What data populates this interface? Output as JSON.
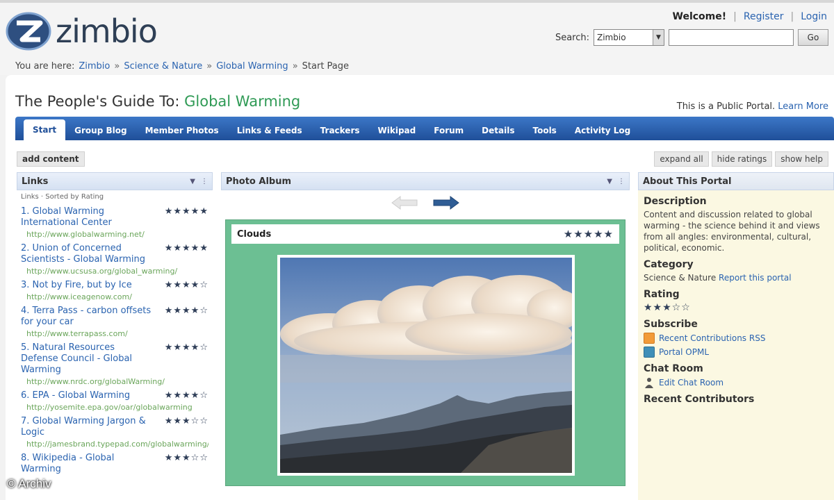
{
  "header": {
    "logo_text": "zimbio",
    "welcome": "Welcome!",
    "register": "Register",
    "login": "Login",
    "search_label": "Search:",
    "search_scope": "Zimbio",
    "go_label": "Go",
    "breadcrumb": {
      "prefix": "You are here:",
      "items": [
        "Zimbio",
        "Science & Nature",
        "Global Warming"
      ],
      "current": "Start Page"
    }
  },
  "portal": {
    "title_prefix": "The People's Guide To:",
    "topic": "Global Warming",
    "public_note": "This is a Public Portal.",
    "learn_more": "Learn More",
    "tabs": [
      "Start",
      "Group Blog",
      "Member Photos",
      "Links & Feeds",
      "Trackers",
      "Wikipad",
      "Forum",
      "Details",
      "Tools",
      "Activity Log"
    ],
    "add_content": "add content",
    "expand_all": "expand all",
    "hide_ratings": "hide ratings",
    "show_help": "show help"
  },
  "links": {
    "title": "Links",
    "subtitle": "Links · Sorted by Rating",
    "items": [
      {
        "title": "1. Global Warming International Center",
        "stars": "★★★★★",
        "url": "http://www.globalwarming.net/"
      },
      {
        "title": "2. Union of Concerned Scientists - Global Warming",
        "stars": "★★★★★",
        "url": "http://www.ucsusa.org/global_warming/"
      },
      {
        "title": "3. Not by Fire, but by Ice",
        "stars": "★★★★☆",
        "url": "http://www.iceagenow.com/"
      },
      {
        "title": "4. Terra Pass - carbon offsets for your car",
        "stars": "★★★★☆",
        "url": "http://www.terrapass.com/"
      },
      {
        "title": "5. Natural Resources Defense Council - Global Warming",
        "stars": "★★★★☆",
        "url": "http://www.nrdc.org/globalWarming/"
      },
      {
        "title": "6. EPA - Global Warming",
        "stars": "★★★★☆",
        "url": "http://yosemite.epa.gov/oar/globalwarming"
      },
      {
        "title": "7. Global Warming Jargon & Logic",
        "stars": "★★★☆☆",
        "url": "http://jamesbrand.typepad.com/globalwarming/"
      },
      {
        "title": "8. Wikipedia - Global Warming",
        "stars": "★★★☆☆",
        "url": ""
      }
    ]
  },
  "photo_album": {
    "title": "Photo Album",
    "caption": "Clouds",
    "stars": "★★★★★"
  },
  "about": {
    "title": "About This Portal",
    "description_h": "Description",
    "description": "Content and discussion related to global warming - the science behind it and views from all angles: environmental, cultural, political, economic.",
    "category_h": "Category",
    "category": "Science & Nature",
    "report": "Report this portal",
    "rating_h": "Rating",
    "rating_stars": "★★★☆☆",
    "subscribe_h": "Subscribe",
    "rss": "Recent Contributions RSS",
    "opml": "Portal OPML",
    "chat_h": "Chat Room",
    "chat_link": "Edit Chat Room",
    "contributors_h": "Recent Contributors"
  },
  "watermark": "© Archiv",
  "colors": {
    "tab_bar": "#1f4f99",
    "link_blue": "#2a63b0",
    "topic_green": "#2f9a55",
    "url_green": "#6aa55a",
    "photo_frame": "#6cbf93",
    "about_bg": "#fbf8e2"
  }
}
